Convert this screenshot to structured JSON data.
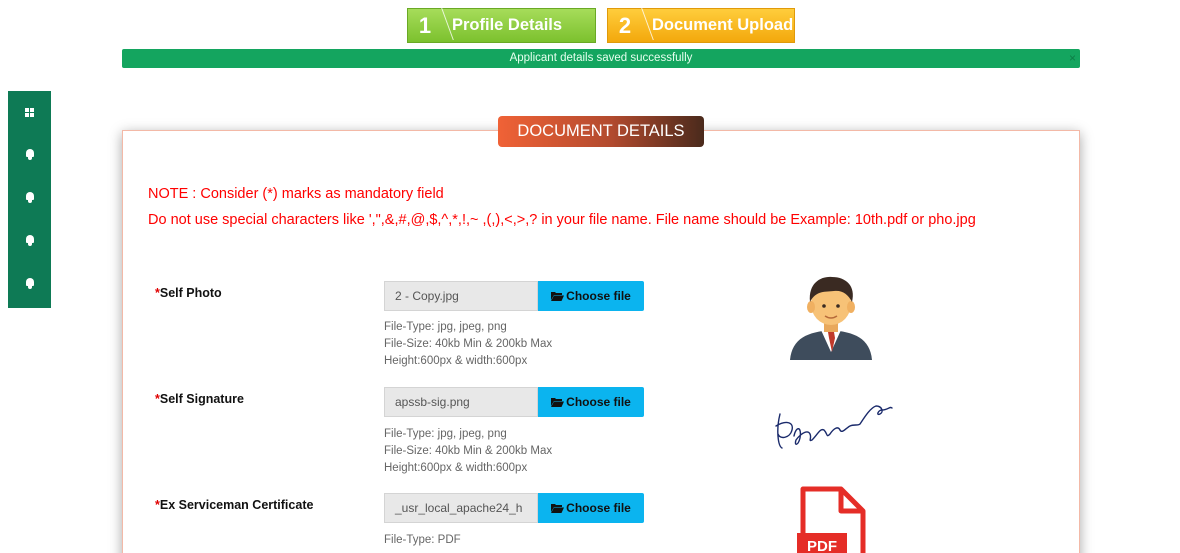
{
  "steps": [
    {
      "number": "1",
      "label": "Profile Details"
    },
    {
      "number": "2",
      "label": "Document Upload"
    }
  ],
  "alert": {
    "message": "Applicant details saved successfully",
    "close": "×"
  },
  "sidebar": {
    "icons": [
      "grid-icon",
      "bell-icon",
      "bell-icon",
      "bell-icon",
      "bell-icon"
    ]
  },
  "card": {
    "title": "DOCUMENT DETAILS"
  },
  "notes": {
    "line1": "NOTE : Consider (*) marks as mandatory field",
    "line2": "Do not use special characters like ',\",&,#,@,$,^,*,!,~ ,(,),<,>,? in your file name. File name should be Example: 10th.pdf or pho.jpg"
  },
  "fields": [
    {
      "label": "Self Photo",
      "required": "*",
      "file": "2 - Copy.jpg",
      "button": "Choose file",
      "hints": [
        "File-Type: jpg, jpeg, png",
        "File-Size: 40kb Min & 200kb Max",
        "Height:600px & width:600px"
      ],
      "preview": "user-avatar"
    },
    {
      "label": "Self Signature",
      "required": "*",
      "file": "apssb-sig.png",
      "button": "Choose file",
      "hints": [
        "File-Type: jpg, jpeg, png",
        "File-Size: 40kb Min & 200kb Max",
        "Height:600px & width:600px"
      ],
      "preview": "signature"
    },
    {
      "label": "Ex Serviceman Certificate",
      "required": "*",
      "file": "_usr_local_apache24_h",
      "button": "Choose file",
      "hints": [
        "File-Type: PDF"
      ],
      "preview": "pdf-file"
    }
  ],
  "pdf_icon_text": "PDF",
  "colors": {
    "step1": "#7cc12e",
    "step2": "#f3a80c",
    "alert": "#14a55f",
    "sidebar": "#0e7a55",
    "button": "#0bb4ef",
    "note": "#ff0000"
  }
}
